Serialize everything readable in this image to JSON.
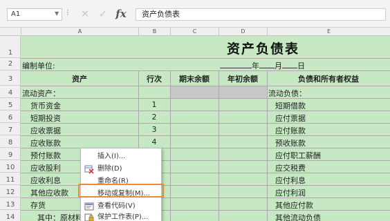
{
  "formula_bar": {
    "name_box": "A1",
    "cancel_icon": "cancel-icon",
    "enter_icon": "enter-icon",
    "fx_label": "fx",
    "content": "资产负债表"
  },
  "columns": [
    "A",
    "B",
    "C",
    "D",
    "E"
  ],
  "rows": [
    "1",
    "2",
    "3",
    "4",
    "5",
    "6",
    "7",
    "8",
    "9",
    "10",
    "11",
    "12",
    "13",
    "14"
  ],
  "sheet": {
    "title": "资产负债表",
    "unit_label": "编制单位:",
    "date_year": "年",
    "date_month": "月",
    "date_day": "日",
    "headers": {
      "assets": "资产",
      "line_no": "行次",
      "end_balance": "期末余额",
      "begin_balance": "年初余额",
      "liabilities": "负债和所有者权益"
    },
    "current_assets": "流动资产：",
    "current_liabilities": "流动负债：",
    "asset_items": [
      {
        "name": "货币资金",
        "line": "1"
      },
      {
        "name": "短期投资",
        "line": "2"
      },
      {
        "name": "应收票据",
        "line": "3"
      },
      {
        "name": "应收账款",
        "line": "4"
      },
      {
        "name": "预付账款",
        "line": ""
      },
      {
        "name": "应收股利",
        "line": ""
      },
      {
        "name": "应收利息",
        "line": ""
      },
      {
        "name": "其他应收款",
        "line": ""
      },
      {
        "name": "存货",
        "line": ""
      },
      {
        "name": "其中：原材料",
        "line": ""
      }
    ],
    "liability_items": [
      "短期借款",
      "应付票据",
      "应付账款",
      "预收账款",
      "应付职工薪酬",
      "应交税费",
      "应付利息",
      "应付利润",
      "其他应付款",
      "其他流动负债"
    ]
  },
  "context_menu": {
    "items": [
      {
        "label": "插入(I)...",
        "icon": "",
        "disabled": false
      },
      {
        "label": "删除(D)",
        "icon": "delete-sheet-icon",
        "disabled": false
      },
      {
        "label": "重命名(R)",
        "icon": "",
        "disabled": false
      },
      {
        "label": "移动或复制(M)...",
        "icon": "",
        "disabled": false,
        "highlighted": true
      },
      {
        "label": "查看代码(V)",
        "icon": "view-code-icon",
        "disabled": false
      },
      {
        "label": "保护工作表(P)...",
        "icon": "protect-sheet-icon",
        "disabled": false
      }
    ]
  },
  "colors": {
    "sheet_fill": "#c6e9c4",
    "highlight_border": "#ea8a3b",
    "gray_fill": "#c8c8c8"
  }
}
